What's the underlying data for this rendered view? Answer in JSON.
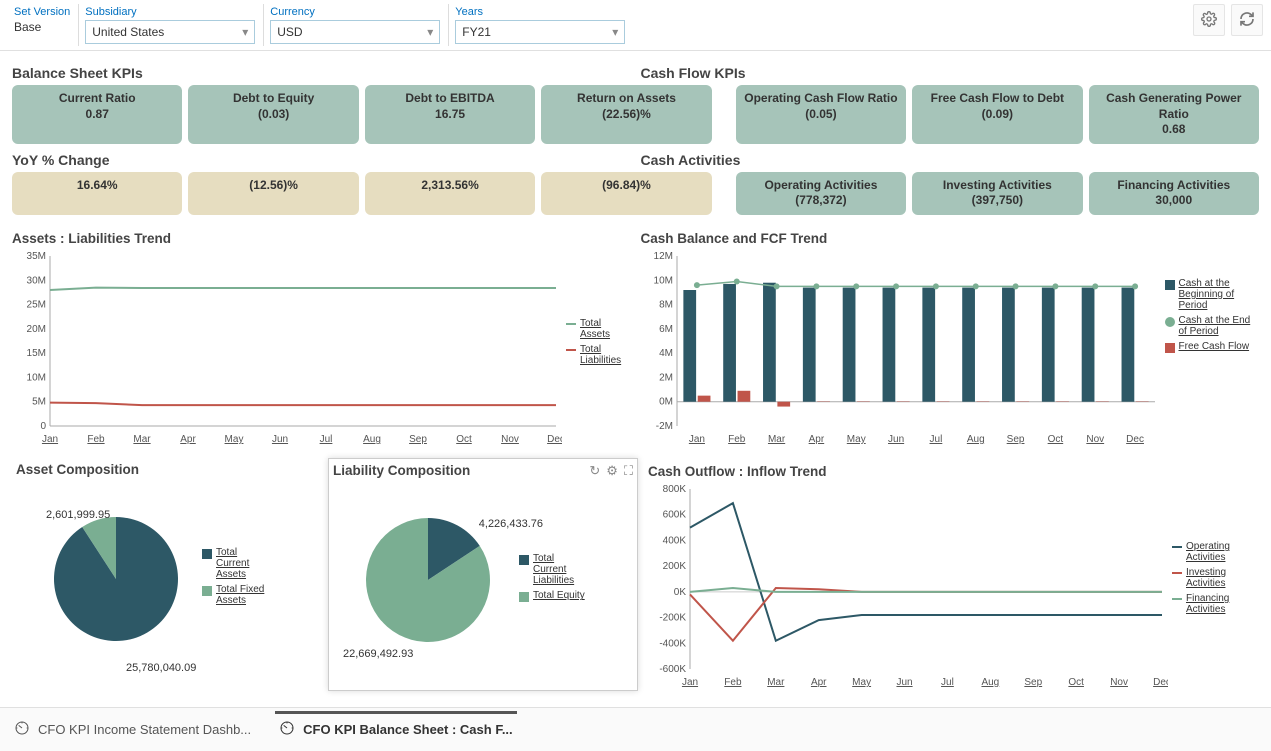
{
  "filters": {
    "set_version_label": "Set Version",
    "set_version_value": "Base",
    "subsidiary_label": "Subsidiary",
    "subsidiary_value": "United States",
    "currency_label": "Currency",
    "currency_value": "USD",
    "years_label": "Years",
    "years_value": "FY21"
  },
  "sections": {
    "balance_sheet_kpis": "Balance Sheet KPIs",
    "cash_flow_kpis": "Cash Flow KPIs",
    "yoy_change": "YoY % Change",
    "cash_activities": "Cash Activities",
    "assets_liab_trend": "Assets : Liabilities Trend",
    "cash_balance_fcf": "Cash Balance and FCF Trend",
    "asset_composition": "Asset Composition",
    "liability_composition": "Liability Composition",
    "cash_outflow_inflow": "Cash Outflow : Inflow Trend"
  },
  "kpis_bs": [
    {
      "label": "Current Ratio",
      "value": "0.87"
    },
    {
      "label": "Debt to Equity",
      "value": "(0.03)"
    },
    {
      "label": "Debt to EBITDA",
      "value": "16.75"
    },
    {
      "label": "Return on Assets",
      "value": "(22.56)%"
    }
  ],
  "kpis_cf": [
    {
      "label": "Operating Cash Flow Ratio",
      "value": "(0.05)"
    },
    {
      "label": "Free Cash Flow to Debt",
      "value": "(0.09)"
    },
    {
      "label": "Cash Generating Power Ratio",
      "value": "0.68"
    }
  ],
  "yoy": [
    {
      "value": "16.64%"
    },
    {
      "value": "(12.56)%"
    },
    {
      "value": "2,313.56%"
    },
    {
      "value": "(96.84)%"
    }
  ],
  "cash_activities": [
    {
      "label": "Operating Activities",
      "value": "(778,372)"
    },
    {
      "label": "Investing Activities",
      "value": "(397,750)"
    },
    {
      "label": "Financing Activities",
      "value": "30,000"
    }
  ],
  "months": [
    "Jan",
    "Feb",
    "Mar",
    "Apr",
    "May",
    "Jun",
    "Jul",
    "Aug",
    "Sep",
    "Oct",
    "Nov",
    "Dec"
  ],
  "assets_liab_legend": {
    "a": "Total Assets",
    "b": "Total Liabilities"
  },
  "cash_balance_legend": {
    "a": "Cash at the Beginning of Period",
    "b": "Cash at the End of Period",
    "c": "Free Cash Flow"
  },
  "asset_comp_legend": {
    "a": "Total Current Assets",
    "b": "Total Fixed Assets"
  },
  "liab_comp_legend": {
    "a": "Total Current Liabilities",
    "b": "Total Equity"
  },
  "outflow_legend": {
    "a": "Operating Activities",
    "b": "Investing Activities",
    "c": "Financing Activities"
  },
  "asset_comp_values": {
    "small": "2,601,999.95",
    "big": "25,780,040.09"
  },
  "liab_comp_values": {
    "small": "4,226,433.76",
    "big": "22,669,492.93"
  },
  "tabs": {
    "t1": "CFO KPI Income Statement Dashb...",
    "t2": "CFO KPI Balance Sheet : Cash F..."
  },
  "chart_data": [
    {
      "type": "line",
      "title": "Assets : Liabilities Trend",
      "ylabel": "",
      "ylim": [
        0,
        35000000
      ],
      "categories": [
        "Jan",
        "Feb",
        "Mar",
        "Apr",
        "May",
        "Jun",
        "Jul",
        "Aug",
        "Sep",
        "Oct",
        "Nov",
        "Dec"
      ],
      "series": [
        {
          "name": "Total Assets",
          "values": [
            28000000,
            28500000,
            28400000,
            28400000,
            28400000,
            28400000,
            28400000,
            28400000,
            28400000,
            28400000,
            28400000,
            28400000
          ]
        },
        {
          "name": "Total Liabilities",
          "values": [
            4800000,
            4700000,
            4300000,
            4300000,
            4300000,
            4300000,
            4300000,
            4300000,
            4300000,
            4300000,
            4300000,
            4300000
          ]
        }
      ]
    },
    {
      "type": "bar",
      "title": "Cash Balance and FCF Trend",
      "ylim": [
        -2000000,
        12000000
      ],
      "categories": [
        "Jan",
        "Feb",
        "Mar",
        "Apr",
        "May",
        "Jun",
        "Jul",
        "Aug",
        "Sep",
        "Oct",
        "Nov",
        "Dec"
      ],
      "series": [
        {
          "name": "Cash at the Beginning of Period",
          "values": [
            9200000,
            9700000,
            9800000,
            9400000,
            9400000,
            9400000,
            9400000,
            9400000,
            9400000,
            9400000,
            9400000,
            9400000
          ]
        },
        {
          "name": "Cash at the End of Period",
          "values": [
            9600000,
            9900000,
            9500000,
            9500000,
            9500000,
            9500000,
            9500000,
            9500000,
            9500000,
            9500000,
            9500000,
            9500000
          ]
        },
        {
          "name": "Free Cash Flow",
          "values": [
            500000,
            900000,
            -400000,
            30000,
            30000,
            30000,
            30000,
            30000,
            30000,
            30000,
            30000,
            30000
          ]
        }
      ]
    },
    {
      "type": "pie",
      "title": "Asset Composition",
      "series": [
        {
          "name": "Total Current Assets",
          "value": 2601999.95
        },
        {
          "name": "Total Fixed Assets",
          "value": 25780040.09
        }
      ]
    },
    {
      "type": "pie",
      "title": "Liability Composition",
      "series": [
        {
          "name": "Total Current Liabilities",
          "value": 4226433.76
        },
        {
          "name": "Total Equity",
          "value": 22669492.93
        }
      ]
    },
    {
      "type": "line",
      "title": "Cash Outflow : Inflow Trend",
      "ylim": [
        -600000,
        800000
      ],
      "categories": [
        "Jan",
        "Feb",
        "Mar",
        "Apr",
        "May",
        "Jun",
        "Jul",
        "Aug",
        "Sep",
        "Oct",
        "Nov",
        "Dec"
      ],
      "series": [
        {
          "name": "Operating Activities",
          "values": [
            500000,
            690000,
            -380000,
            -220000,
            -180000,
            -180000,
            -180000,
            -180000,
            -180000,
            -180000,
            -180000,
            -180000
          ]
        },
        {
          "name": "Investing Activities",
          "values": [
            -20000,
            -380000,
            30000,
            20000,
            0,
            0,
            0,
            0,
            0,
            0,
            0,
            0
          ]
        },
        {
          "name": "Financing Activities",
          "values": [
            0,
            30000,
            0,
            0,
            0,
            0,
            0,
            0,
            0,
            0,
            0,
            0
          ]
        }
      ]
    }
  ],
  "y_ticks_assets": [
    "0",
    "5M",
    "10M",
    "15M",
    "20M",
    "25M",
    "30M",
    "35M"
  ],
  "y_ticks_cash": [
    "-2M",
    "0M",
    "2M",
    "4M",
    "6M",
    "8M",
    "10M",
    "12M"
  ],
  "y_ticks_outflow": [
    "-600K",
    "-400K",
    "-200K",
    "0K",
    "200K",
    "400K",
    "600K",
    "800K"
  ]
}
